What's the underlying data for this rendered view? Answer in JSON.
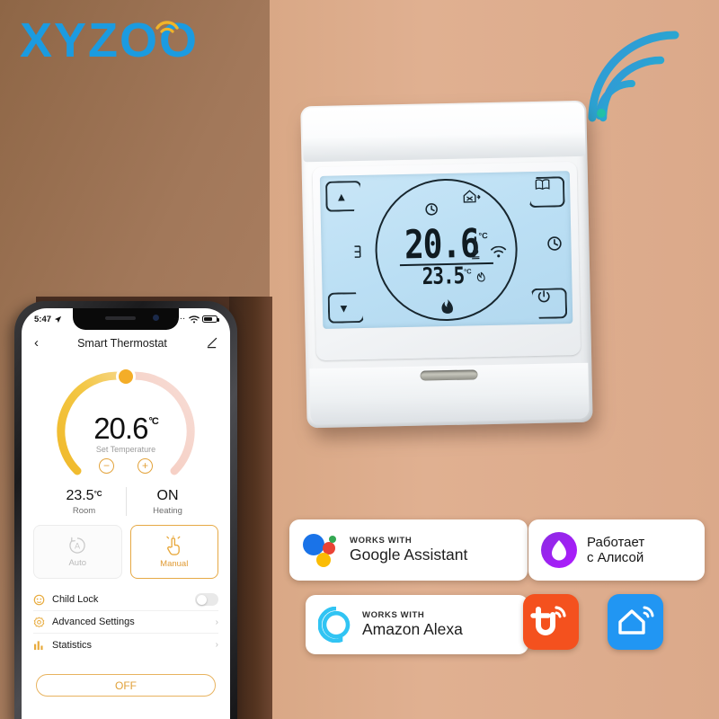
{
  "brand": {
    "logo_text": "XYZOO",
    "logo_color": "#1b9be0",
    "wifi_accent": "#f0b429"
  },
  "device": {
    "name": "smart-thermostat",
    "lcd": {
      "set_temperature": "20.6",
      "set_unit": "°C",
      "room_temperature": "23.5",
      "room_unit": "°C",
      "icons": [
        "clock-icon",
        "house-away-icon",
        "wifi-icon",
        "thermometer-icon",
        "flame-icon",
        "floor-heat-icon",
        "antenna-icon"
      ],
      "buttons": [
        {
          "name": "up-button",
          "glyph": "▲"
        },
        {
          "name": "down-button",
          "glyph": "▼"
        },
        {
          "name": "program-button",
          "glyph": "▥"
        },
        {
          "name": "power-button",
          "glyph": "⏻"
        }
      ],
      "side_clock_label": "clock-icon"
    }
  },
  "phone": {
    "status": {
      "time": "5:47",
      "location_icon": "location-arrow-icon",
      "signal": "····",
      "wifi": "wifi-icon",
      "battery": "battery-icon"
    },
    "header": {
      "back": "‹",
      "title": "Smart Thermostat",
      "edit": "edit-icon"
    },
    "dial": {
      "temperature": "20.6",
      "unit": "°C",
      "caption": "Set Temperature",
      "minus": "−",
      "plus": "+",
      "arc_active_color": "#eeb42c",
      "arc_inactive_color": "#f4d9d4"
    },
    "readouts": [
      {
        "value": "23.5",
        "unit": "°C",
        "caption": "Room"
      },
      {
        "value": "ON",
        "unit": "",
        "caption": "Heating"
      }
    ],
    "modes": [
      {
        "label": "Auto",
        "icon": "auto-circle-icon",
        "active": false
      },
      {
        "label": "Manual",
        "icon": "hand-touch-icon",
        "active": true
      }
    ],
    "rows": [
      {
        "label": "Child Lock",
        "icon": "child-lock-icon",
        "control": "toggle",
        "value": "off"
      },
      {
        "label": "Advanced Settings",
        "icon": "gear-icon",
        "control": "chevron",
        "value": "›"
      },
      {
        "label": "Statistics",
        "icon": "bar-chart-icon",
        "control": "chevron",
        "value": "›"
      }
    ],
    "power_button": "OFF"
  },
  "badges": [
    {
      "kicker": "WORKS WITH",
      "name": "Google Assistant",
      "icon": "google-assistant-icon"
    },
    {
      "kicker": "",
      "name_line1": "Работает",
      "name_line2": "с Алисой",
      "icon": "yandex-alice-icon"
    },
    {
      "kicker": "WORKS WITH",
      "name": "Amazon Alexa",
      "icon": "amazon-alexa-icon"
    }
  ],
  "app_icons": [
    {
      "name": "tuya-icon",
      "letter": "t",
      "color": "#f4511e"
    },
    {
      "name": "smart-life-icon",
      "glyph": "house",
      "color": "#2196f3"
    }
  ]
}
